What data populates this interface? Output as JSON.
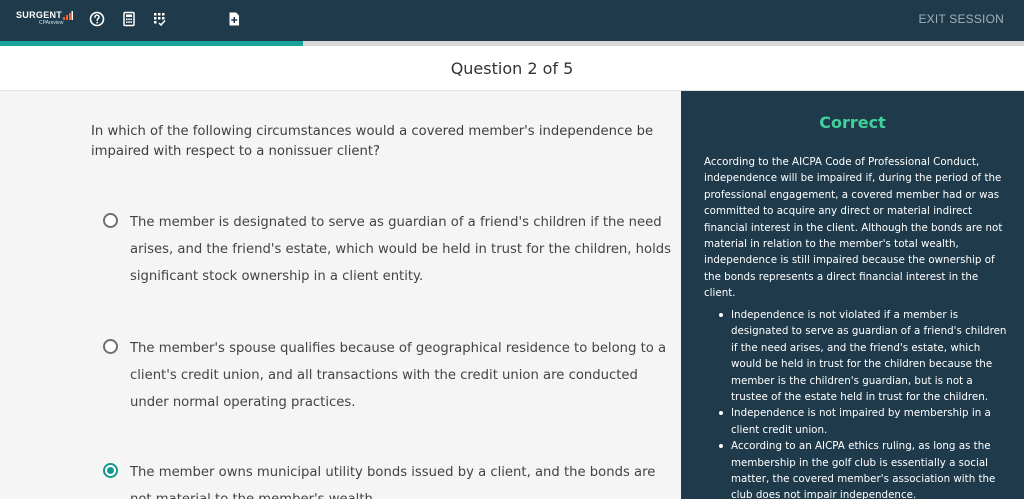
{
  "topbar": {
    "logo_text": "SURGENT",
    "logo_subtext": "CPAreview",
    "icons": [
      "help-icon",
      "calculator-icon",
      "spreadsheet-icon",
      "add-document-icon"
    ],
    "exit_label": "EXIT SESSION",
    "colors": {
      "bar": "#1f3a4b",
      "accent": "#1aa39b",
      "logo_bars": "#e8623a"
    }
  },
  "progress": {
    "current": 2,
    "total": 5
  },
  "question": {
    "title": "Question 2 of 5",
    "prompt": "In which of the following circumstances would a covered member's independence be impaired with respect to a nonissuer client?",
    "options": [
      {
        "text": "The member is designated to serve as guardian of a friend's children if the need arises, and the friend's estate, which would be held in trust for the children, holds significant stock ownership in a client entity.",
        "selected": false
      },
      {
        "text": "The member's spouse qualifies because of geographical residence to belong to a client's credit union, and all transactions with the credit union are conducted under normal operating practices.",
        "selected": false
      },
      {
        "text": "The member owns municipal utility bonds issued by a client, and the bonds are not material to the member's wealth.",
        "selected": true
      }
    ]
  },
  "feedback": {
    "result": "Correct",
    "result_color": "#3fd29b",
    "explanation": "According to the AICPA Code of Professional Conduct, independence will be impaired if, during the period of the professional engagement, a covered member had or was committed to acquire any direct or material indirect financial interest in the client. Although the bonds are not material in relation to the member's total wealth, independence is still impaired because the ownership of the bonds represents a direct financial interest in the client.",
    "bullets": [
      "Independence is not violated if a member is designated to serve as guardian of a friend's children if the need arises, and the friend's estate, which would be held in trust for the children because the member is the children's guardian, but is not a trustee of the estate held in trust for the children.",
      "Independence is not impaired by membership in a client credit union.",
      "According to an AICPA ethics ruling, as long as the membership in the golf club is essentially a social matter, the covered member's association with the club does not impair independence."
    ]
  }
}
